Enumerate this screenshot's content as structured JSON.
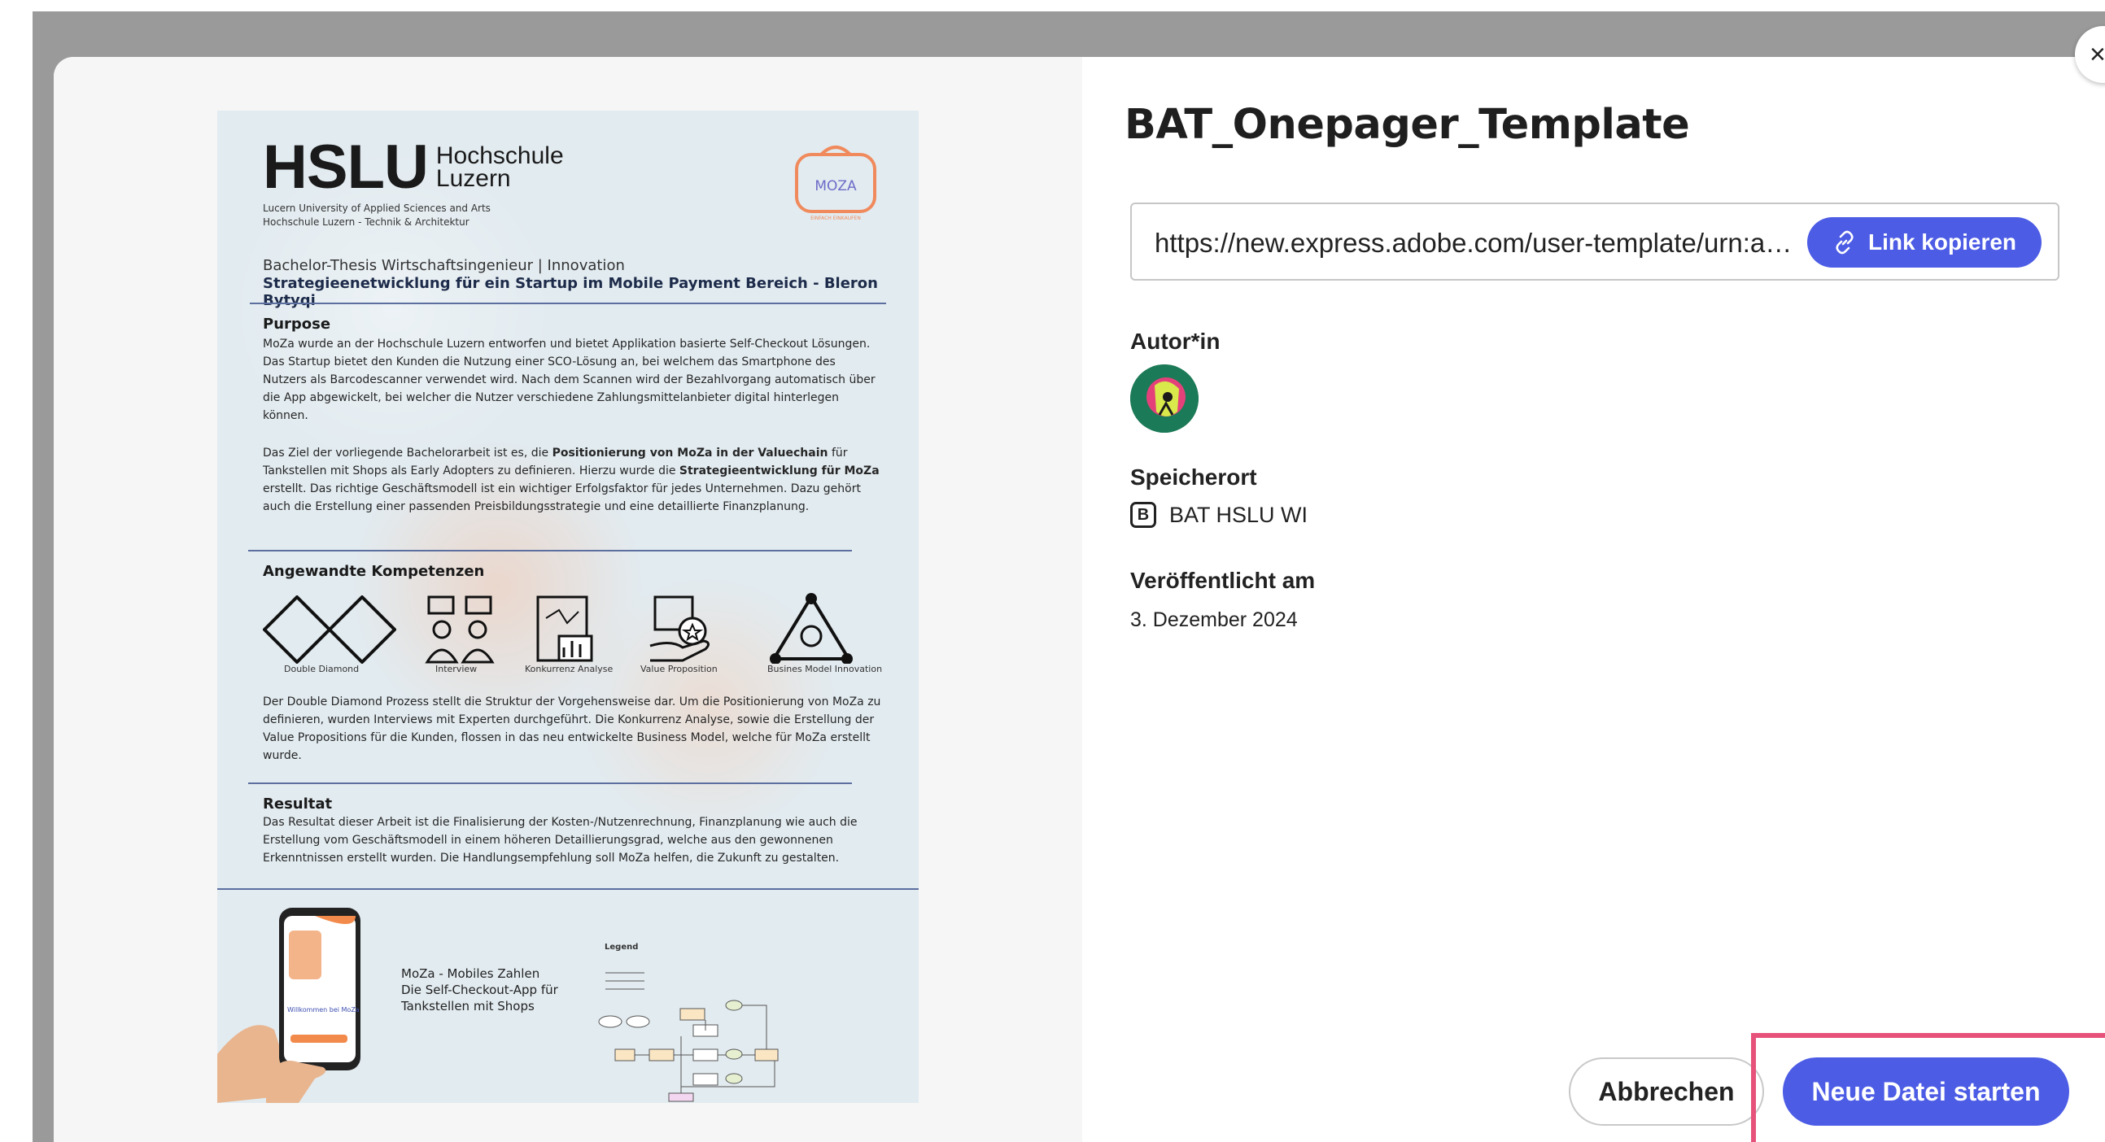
{
  "dialog": {
    "template_title": "BAT_Onepager_Template",
    "share_link": "https://new.express.adobe.com/user-template/urn:aaid:...",
    "copy_link_label": "Link kopieren",
    "author_label": "Autor*in",
    "location_label": "Speicherort",
    "location_icon_letter": "B",
    "location_value": "BAT HSLU WI",
    "published_label": "Veröffentlicht am",
    "published_value": "3. Dezember 2024",
    "cancel_label": "Abbrechen",
    "start_label": "Neue Datei starten",
    "close_glyph": "×",
    "accent_color": "#4c5ce5",
    "highlight_color": "#e6527a"
  },
  "poster": {
    "logo_mark": "HSLU",
    "logo_word_1": "Hochschule",
    "logo_word_2": "Luzern",
    "logo_sub_1": "Lucern University of Applied Sciences and Arts",
    "logo_sub_2": "Hochschule Luzern - Technik & Architektur",
    "moza_logo_text": "MOZA",
    "moza_logo_tagline": "EINFACH EINKAUFEN",
    "subtitle": "Bachelor-Thesis Wirtschaftsingenieur | Innovation",
    "title": "Strategieenetwicklung für ein Startup im Mobile Payment Bereich - Bleron Bytyqi",
    "purpose_heading": "Purpose",
    "purpose_p1": "MoZa wurde an der Hochschule Luzern entworfen und bietet Applikation basierte Self-Checkout Lösungen. Das Startup bietet den Kunden die Nutzung einer SCO-Lösung an, bei welchem das Smartphone des Nutzers als Barcodescanner verwendet wird. Nach dem Scannen wird der Bezahlvorgang automatisch über die App abgewickelt, bei welcher die Nutzer verschiedene Zahlungsmittelanbieter digital hinterlegen können.",
    "purpose_p2_a": "Das Ziel der vorliegende Bachelorarbeit ist es, die ",
    "purpose_p2_b": "Positionierung von MoZa in der Valuechain",
    "purpose_p2_c": " für Tankstellen mit Shops als Early Adopters zu definieren. Hierzu wurde die ",
    "purpose_p2_d": "Strategieentwicklung für MoZa",
    "purpose_p2_e": " erstellt. Das richtige Geschäftsmodell ist ein wichtiger Erfolgsfaktor für jedes Unternehmen. Dazu gehört auch die Erstellung einer passenden Preisbildungsstrategie und eine detaillierte Finanzplanung.",
    "competencies_heading": "Angewandte Kompetenzen",
    "icon_captions": [
      "Double Diamond",
      "Interview",
      "Konkurrenz Analyse",
      "Value Proposition",
      "Busines Model Innovation"
    ],
    "competencies_text": "Der Double Diamond Prozess stellt die Struktur der Vorgehensweise dar. Um die Positionierung von MoZa zu definieren, wurden Interviews mit Experten durchgeführt. Die Konkurrenz Analyse, sowie die Erstellung der Value Propositions für die Kunden, flossen in das neu entwickelte Business Model, welche für MoZa erstellt wurde.",
    "result_heading": "Resultat",
    "result_text": "Das Resultat dieser Arbeit ist die Finalisierung der Kosten-/Nutzenrechnung, Finanzplanung wie auch die Erstellung vom Geschäftsmodell in einem höheren Detaillierungsgrad, welche aus den gewonnenen Erkenntnissen erstellt wurden. Die Handlungsempfehlung soll MoZa helfen, die Zukunft zu gestalten.",
    "moza_caption_1": "MoZa - Mobiles Zahlen",
    "moza_caption_2": "Die Self-Checkout-App für",
    "moza_caption_3": "Tankstellen mit Shops",
    "legend_label": "Legend",
    "phone_screen_text": "Willkommen bei MoZa"
  }
}
